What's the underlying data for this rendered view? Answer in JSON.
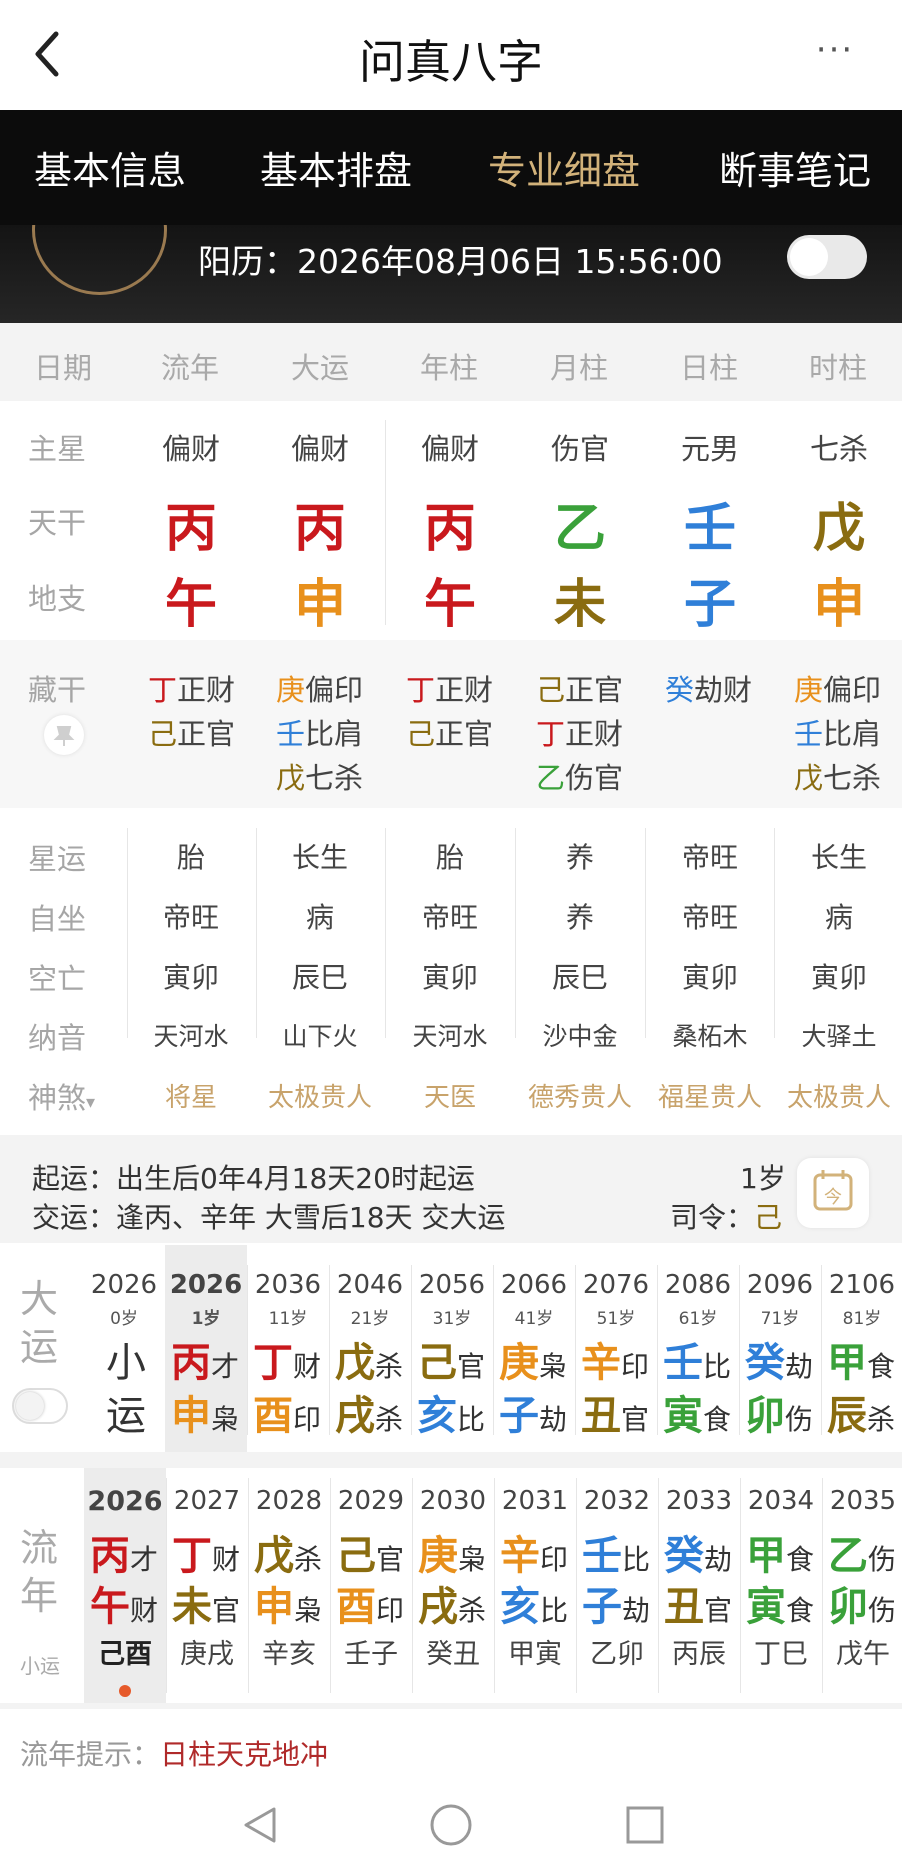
{
  "app": {
    "title": "问真八字",
    "more": "···"
  },
  "tabs": [
    "基本信息",
    "基本排盘",
    "专业细盘",
    "断事笔记"
  ],
  "solar_date": "阳历：2026年08月06日 15:56:00",
  "columns": [
    "日期",
    "流年",
    "大运",
    "年柱",
    "月柱",
    "日柱",
    "时柱"
  ],
  "row_labels": {
    "main_star": "主星",
    "tiangan": "天干",
    "dizhi": "地支",
    "canggan": "藏干",
    "xingyun": "星运",
    "zizuo": "自坐",
    "kongwang": "空亡",
    "nayin": "纳音",
    "shensha": "神煞"
  },
  "shensha_caret": "▾",
  "main_stars": [
    "偏财",
    "偏财",
    "偏财",
    "伤官",
    "元男",
    "七杀"
  ],
  "tiangan": [
    "丙",
    "丙",
    "丙",
    "乙",
    "壬",
    "戊"
  ],
  "dizhi": [
    "午",
    "申",
    "午",
    "未",
    "子",
    "申"
  ],
  "canggan": [
    [
      [
        "丁",
        "正财"
      ],
      [
        "己",
        "正官"
      ]
    ],
    [
      [
        "庚",
        "偏印"
      ],
      [
        "壬",
        "比肩"
      ],
      [
        "戊",
        "七杀"
      ]
    ],
    [
      [
        "丁",
        "正财"
      ],
      [
        "己",
        "正官"
      ]
    ],
    [
      [
        "己",
        "正官"
      ],
      [
        "丁",
        "正财"
      ],
      [
        "乙",
        "伤官"
      ]
    ],
    [
      [
        "癸",
        "劫财"
      ]
    ],
    [
      [
        "庚",
        "偏印"
      ],
      [
        "壬",
        "比肩"
      ],
      [
        "戊",
        "七杀"
      ]
    ]
  ],
  "xingyun": [
    "胎",
    "长生",
    "胎",
    "养",
    "帝旺",
    "长生"
  ],
  "zizuo": [
    "帝旺",
    "病",
    "帝旺",
    "养",
    "帝旺",
    "病"
  ],
  "kongwang": [
    "寅卯",
    "辰巳",
    "寅卯",
    "辰巳",
    "寅卯",
    "寅卯"
  ],
  "nayin": [
    "天河水",
    "山下火",
    "天河水",
    "沙中金",
    "桑柘木",
    "大驿土"
  ],
  "shensha": [
    "将星",
    "太极贵人",
    "天医",
    "德秀贵人",
    "福星贵人",
    "太极贵人"
  ],
  "qiyun": {
    "label1": "起运：",
    "text1": "出生后0年4月18天20时起运",
    "age": "1岁",
    "label2": "交运：",
    "text2": "逢丙、辛年 大雪后18天 交大运",
    "siling_label": "司令：",
    "siling_value": "己",
    "cal_icon_text": "今"
  },
  "dayun": {
    "label": [
      "大",
      "运"
    ],
    "first": {
      "year": "2026",
      "age": "0岁",
      "chars": [
        "小",
        "运"
      ]
    },
    "items": [
      {
        "year": "2026",
        "age": "1岁",
        "gan": "丙",
        "gs": "才",
        "zhi": "申",
        "zs": "枭"
      },
      {
        "year": "2036",
        "age": "11岁",
        "gan": "丁",
        "gs": "财",
        "zhi": "酉",
        "zs": "印"
      },
      {
        "year": "2046",
        "age": "21岁",
        "gan": "戊",
        "gs": "杀",
        "zhi": "戌",
        "zs": "杀"
      },
      {
        "year": "2056",
        "age": "31岁",
        "gan": "己",
        "gs": "官",
        "zhi": "亥",
        "zs": "比"
      },
      {
        "year": "2066",
        "age": "41岁",
        "gan": "庚",
        "gs": "枭",
        "zhi": "子",
        "zs": "劫"
      },
      {
        "year": "2076",
        "age": "51岁",
        "gan": "辛",
        "gs": "印",
        "zhi": "丑",
        "zs": "官"
      },
      {
        "year": "2086",
        "age": "61岁",
        "gan": "壬",
        "gs": "比",
        "zhi": "寅",
        "zs": "食"
      },
      {
        "year": "2096",
        "age": "71岁",
        "gan": "癸",
        "gs": "劫",
        "zhi": "卯",
        "zs": "伤"
      },
      {
        "year": "2106",
        "age": "81岁",
        "gan": "甲",
        "gs": "食",
        "zhi": "辰",
        "zs": "杀"
      }
    ]
  },
  "liunian": {
    "label": [
      "流",
      "年"
    ],
    "sub": "小运",
    "items": [
      {
        "year": "2026",
        "gan": "丙",
        "gs": "才",
        "zhi": "午",
        "zs": "财",
        "xy": "己酉"
      },
      {
        "year": "2027",
        "gan": "丁",
        "gs": "财",
        "zhi": "未",
        "zs": "官",
        "xy": "庚戌"
      },
      {
        "year": "2028",
        "gan": "戊",
        "gs": "杀",
        "zhi": "申",
        "zs": "枭",
        "xy": "辛亥"
      },
      {
        "year": "2029",
        "gan": "己",
        "gs": "官",
        "zhi": "酉",
        "zs": "印",
        "xy": "壬子"
      },
      {
        "year": "2030",
        "gan": "庚",
        "gs": "枭",
        "zhi": "戌",
        "zs": "杀",
        "xy": "癸丑"
      },
      {
        "year": "2031",
        "gan": "辛",
        "gs": "印",
        "zhi": "亥",
        "zs": "比",
        "xy": "甲寅"
      },
      {
        "year": "2032",
        "gan": "壬",
        "gs": "比",
        "zhi": "子",
        "zs": "劫",
        "xy": "乙卯"
      },
      {
        "year": "2033",
        "gan": "癸",
        "gs": "劫",
        "zhi": "丑",
        "zs": "官",
        "xy": "丙辰"
      },
      {
        "year": "2034",
        "gan": "甲",
        "gs": "食",
        "zhi": "寅",
        "zs": "食",
        "xy": "丁巳"
      },
      {
        "year": "2035",
        "gan": "乙",
        "gs": "伤",
        "zhi": "卯",
        "zs": "伤",
        "xy": "戊午"
      }
    ]
  },
  "hint": {
    "label": "流年提示：",
    "text": "日柱天克地冲"
  },
  "colors": {
    "fire": "#c9191d",
    "metal": "#e8901c",
    "wood": "#3aa13a",
    "water": "#2f7fd8",
    "earth": "#8a6c10",
    "tab_active": "#d2b27a",
    "shensha": "#c8a36b",
    "hint": "#b02a2a"
  }
}
